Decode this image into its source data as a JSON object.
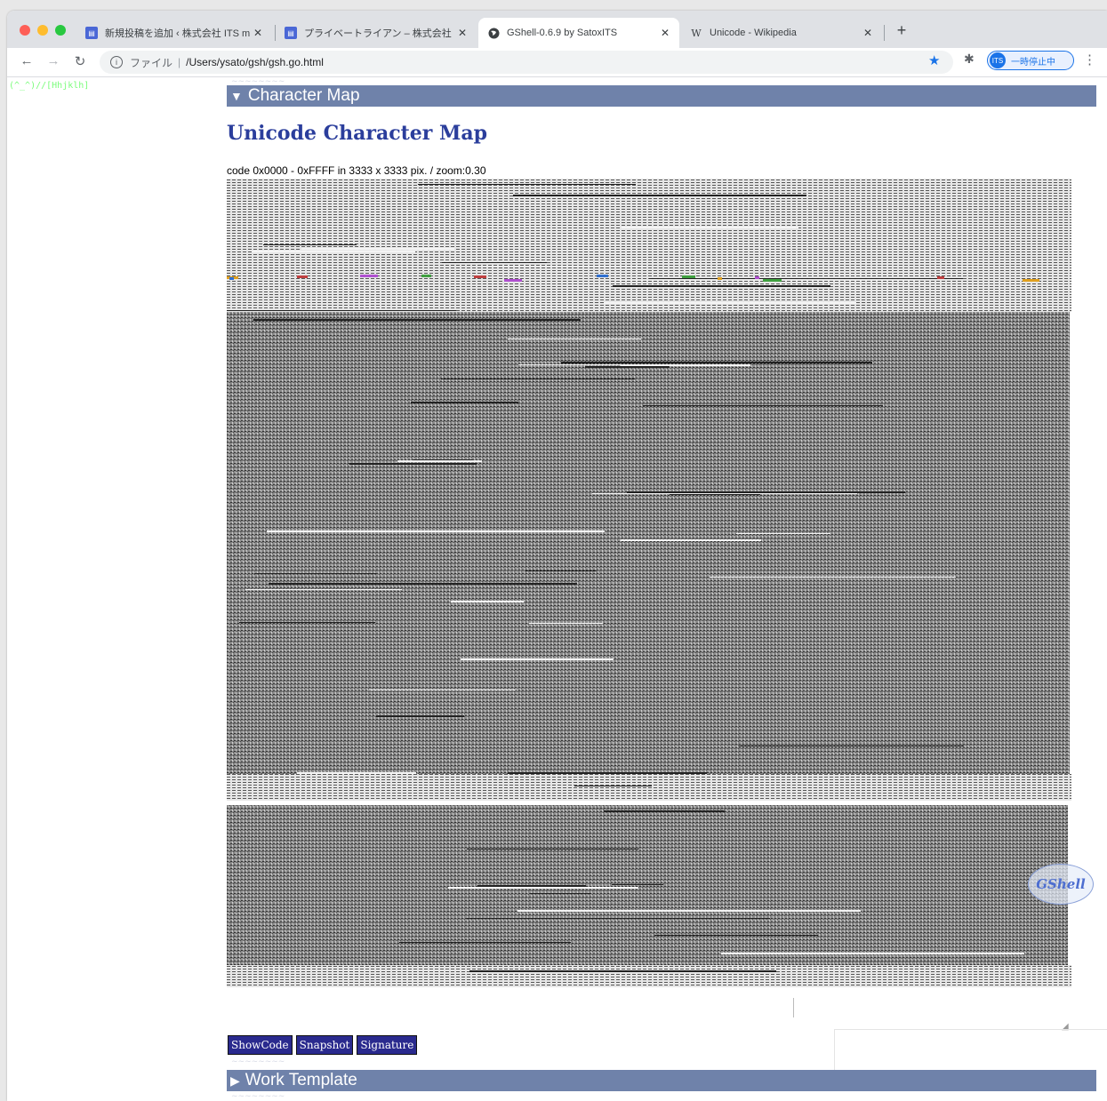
{
  "browser": {
    "tabs": [
      {
        "title": "新規投稿を追加 ‹ 株式会社 ITS m",
        "favicon": "doc-icon",
        "active": false
      },
      {
        "title": "プライベートライアン – 株式会社",
        "favicon": "doc-icon",
        "active": false
      },
      {
        "title": "GShell-0.6.9 by SatoxITS",
        "favicon": "globe-icon",
        "active": true
      },
      {
        "title": "Unicode - Wikipedia",
        "favicon": "W",
        "active": false
      }
    ],
    "close_glyph": "✕",
    "new_tab": "+",
    "back": "←",
    "forward": "→",
    "reload": "↻",
    "address": {
      "info": "i",
      "scheme": "ファイル",
      "divider": "|",
      "path": "/Users/ysato/gsh/gsh.go.html"
    },
    "star": "★",
    "extensions": "✱",
    "profile": {
      "avatar": "ITS",
      "label": "一時停止中"
    },
    "menu": "⋮"
  },
  "page": {
    "corner_text": "(^_^)//[Hhjklh]",
    "char_map_section": {
      "arrow": "▼",
      "label": "Character Map"
    },
    "title": "Unicode Character Map",
    "code_info": "code 0x0000 - 0xFFFF in 3333 x 3333 pix. / zoom:0.30",
    "buttons": [
      "ShowCode",
      "Snapshot",
      "Signature"
    ],
    "logo": "GShell",
    "work_section": {
      "arrow": "▶",
      "label": "Work Template"
    }
  },
  "colors": {
    "section_bar": "#6f82aa",
    "title": "#2b3e9c",
    "button_bg": "#2a2a8e",
    "corner_text": "#7cfc7c"
  }
}
